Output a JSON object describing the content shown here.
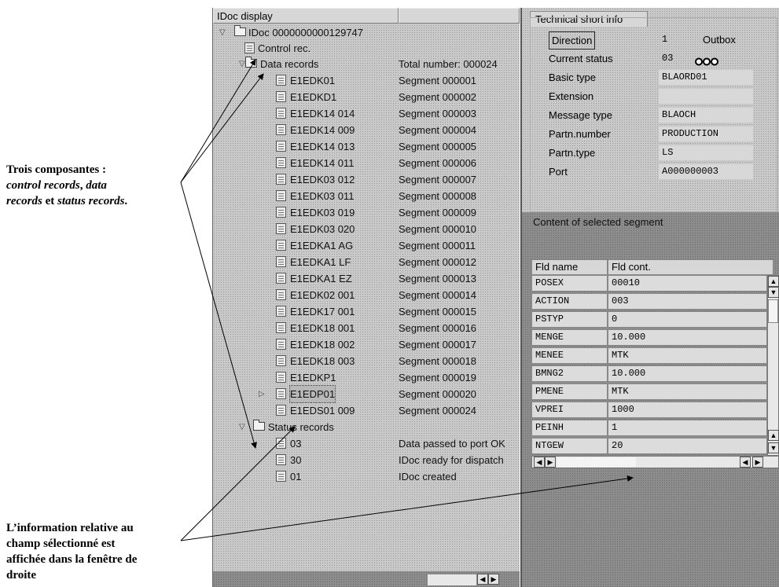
{
  "annotations": {
    "top": {
      "line1": "Trois composantes :",
      "line2_it1": "control records",
      "line2_sep": ", ",
      "line2_it2": "data",
      "line3_it1": "records",
      "line3_mid": " et ",
      "line3_it2": "status records",
      "line3_end": "."
    },
    "bottom": {
      "line1": "L’information relative au",
      "line2": "champ sélectionné est",
      "line3": "affichée dans la fenêtre de",
      "line4": "droite"
    }
  },
  "tree": {
    "header_col1": "IDoc display",
    "header_col2": "",
    "root_label": "IDoc 0000000000129747",
    "control_label": "Control rec.",
    "data_folder_label": "Data records",
    "data_folder_value": "Total number: 000024",
    "segments": [
      {
        "name": "E1EDK01",
        "segment": "Segment 000001"
      },
      {
        "name": "E1EDKD1",
        "segment": "Segment 000002"
      },
      {
        "name": "E1EDK14 014",
        "segment": "Segment 000003"
      },
      {
        "name": "E1EDK14 009",
        "segment": "Segment 000004"
      },
      {
        "name": "E1EDK14 013",
        "segment": "Segment 000005"
      },
      {
        "name": "E1EDK14 011",
        "segment": "Segment 000006"
      },
      {
        "name": "E1EDK03 012",
        "segment": "Segment 000007"
      },
      {
        "name": "E1EDK03 011",
        "segment": "Segment 000008"
      },
      {
        "name": "E1EDK03 019",
        "segment": "Segment 000009"
      },
      {
        "name": "E1EDK03 020",
        "segment": "Segment 000010"
      },
      {
        "name": "E1EDKA1 AG",
        "segment": "Segment 000011"
      },
      {
        "name": "E1EDKA1 LF",
        "segment": "Segment 000012"
      },
      {
        "name": "E1EDKA1 EZ",
        "segment": "Segment 000013"
      },
      {
        "name": "E1EDK02 001",
        "segment": "Segment 000014"
      },
      {
        "name": "E1EDK17 001",
        "segment": "Segment 000015"
      },
      {
        "name": "E1EDK18 001",
        "segment": "Segment 000016"
      },
      {
        "name": "E1EDK18 002",
        "segment": "Segment 000017"
      },
      {
        "name": "E1EDK18 003",
        "segment": "Segment 000018"
      },
      {
        "name": "E1EDKP1",
        "segment": "Segment 000019"
      },
      {
        "name": "E1EDP01",
        "segment": "Segment 000020"
      },
      {
        "name": "E1EDS01 009",
        "segment": "Segment 000024"
      }
    ],
    "status_folder_label": "Status records",
    "statuses": [
      {
        "code": "03",
        "text": "Data passed to port OK"
      },
      {
        "code": "30",
        "text": "IDoc ready for dispatch"
      },
      {
        "code": "01",
        "text": "IDoc created"
      }
    ]
  },
  "tech_info": {
    "tab_label": "Technical short info",
    "rows": [
      {
        "label": "Direction",
        "value": "1",
        "extra": "Outbox"
      },
      {
        "label": "Current status",
        "value": "03",
        "extra": ""
      },
      {
        "label": "Basic type",
        "value": "BLAORD01"
      },
      {
        "label": "Extension",
        "value": ""
      },
      {
        "label": "Message type",
        "value": "BLAOCH"
      },
      {
        "label": "Partn.number",
        "value": "PRODUCTION"
      },
      {
        "label": "Partn.type",
        "value": "LS"
      },
      {
        "label": "Port",
        "value": "A000000003"
      }
    ]
  },
  "content": {
    "label": "Content of selected segment",
    "col1": "Fld name",
    "col2": "Fld cont.",
    "rows": [
      {
        "name": "POSEX",
        "value": "00010"
      },
      {
        "name": "ACTION",
        "value": "003"
      },
      {
        "name": "PSTYP",
        "value": "0"
      },
      {
        "name": "MENGE",
        "value": "10.000"
      },
      {
        "name": "MENEE",
        "value": "MTK"
      },
      {
        "name": "BMNG2",
        "value": "10.000"
      },
      {
        "name": "PMENE",
        "value": "MTK"
      },
      {
        "name": "VPREI",
        "value": "1000"
      },
      {
        "name": "PEINH",
        "value": "1"
      },
      {
        "name": "NTGEW",
        "value": "20"
      }
    ]
  },
  "icons": {
    "expanded": "triangle-down-icon",
    "collapsed": "triangle-right-icon",
    "status_lights": "traffic-light-icon",
    "scroll_left": "scroll-left-icon",
    "scroll_right": "scroll-right-icon",
    "scroll_up": "scroll-up-icon",
    "scroll_down": "scroll-down-icon"
  }
}
